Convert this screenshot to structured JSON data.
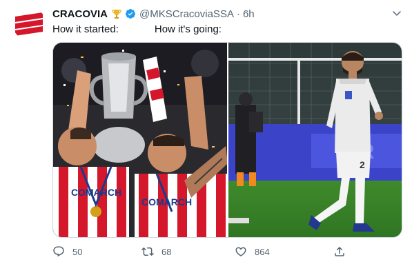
{
  "tweet": {
    "display_name": "CRACOVIA",
    "handle": "@MKSCracoviaSSA",
    "separator": "·",
    "time": "6h",
    "text_part1": "How it started:",
    "text_part2": "How it's going:"
  },
  "actions": {
    "reply_count": "50",
    "retweet_count": "68",
    "like_count": "864"
  },
  "media": {
    "left_photo_caption": "COMARCH",
    "right_photo_shirt_number": "2"
  },
  "colors": {
    "text_primary": "#0f1419",
    "text_secondary": "#536471",
    "verified_blue": "#1d9bf0",
    "cracovia_red": "#d5172b",
    "pitch_green": "#3f8a2c"
  },
  "icons": {
    "trophy": "trophy-icon",
    "verified": "verified-badge-icon",
    "more": "chevron-down-icon",
    "reply": "reply-icon",
    "retweet": "retweet-icon",
    "like": "heart-icon",
    "share": "share-icon"
  }
}
